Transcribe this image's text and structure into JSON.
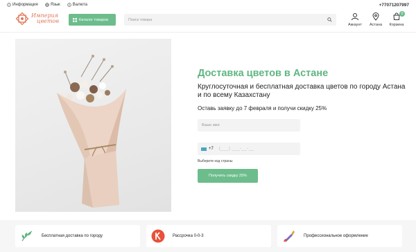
{
  "topbar": {
    "info_label": "Информация",
    "language_label": "Язык",
    "currency_label": "Валюта",
    "phone": "+77071207997"
  },
  "header": {
    "logo_line1": "Империя",
    "logo_line2": "цветов",
    "catalog_label": "Каталог товаров",
    "search_placeholder": "Поиск товара",
    "account_label": "Аккаунт",
    "location_label": "Астана",
    "cart_label": "Корзина",
    "cart_count": "0"
  },
  "hero": {
    "title": "Доставка цветов в Астане",
    "subtitle": "Круглосуточная и бесплатная доставка цветов по городу Астана и по всему Казахстану",
    "offer": "Оставь заявку до 7 февраля и получи скидку 25%",
    "name_placeholder": "Ваше имя",
    "phone_code": "+7",
    "phone_mask": "(___) ___-__-__",
    "country_hint": "Выберите код страны",
    "submit_label": "Получить скидку 25%"
  },
  "features": [
    {
      "label": "Бесплатная доставка по городу",
      "icon": "leaf-icon"
    },
    {
      "label": "Рассрочка 0-0-3",
      "icon": "kaspi-icon"
    },
    {
      "label": "Профессиональное оформление",
      "icon": "brush-icon"
    }
  ],
  "colors": {
    "accent": "#6dbd8c",
    "title": "#5fb582",
    "logo": "#e0795a",
    "kaspi": "#e8513a"
  }
}
